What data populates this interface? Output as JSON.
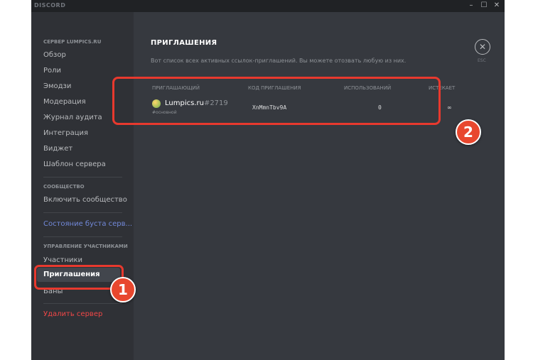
{
  "app": {
    "name": "DISCORD"
  },
  "window_controls": {
    "minimize": "–",
    "maximize": "☐",
    "close": "✕"
  },
  "sidebar": {
    "server_header": "СЕРВЕР LUMPICS.RU",
    "items": [
      "Обзор",
      "Роли",
      "Эмодзи",
      "Модерация",
      "Журнал аудита",
      "Интеграция",
      "Виджет",
      "Шаблон сервера"
    ],
    "community_header": "СООБЩЕСТВО",
    "community_items": [
      "Включить сообщество"
    ],
    "boost_status": "Состояние буста серв...",
    "members_header": "УПРАВЛЕНИЕ УЧАСТНИКАМИ",
    "members_items": [
      "Участники",
      "Приглашения",
      "Баны"
    ],
    "active_item": "Приглашения",
    "delete_server": "Удалить сервер"
  },
  "main": {
    "title": "ПРИГЛАШЕНИЯ",
    "description": "Вот список всех активных ссылок-приглашений. Вы можете отозвать любую из них.",
    "close_label": "ESC",
    "close_icon": "✕",
    "table": {
      "columns": [
        "ПРИГЛАШАЮЩИЙ",
        "КОД ПРИГЛАШЕНИЯ",
        "ИСПОЛЬЗОВАНИЙ",
        "ИСТЕКАЕТ"
      ],
      "rows": [
        {
          "inviter_name": "Lumpics.ru",
          "inviter_tag": "#2719",
          "channel": "#основной",
          "code": "XnMmnTbv9A",
          "uses": "0",
          "expires": "∞"
        }
      ]
    }
  },
  "annotations": {
    "badge1": "1",
    "badge2": "2"
  },
  "colors": {
    "highlight": "#e8392e",
    "background": "#36393f",
    "sidebar": "#2f3136"
  }
}
